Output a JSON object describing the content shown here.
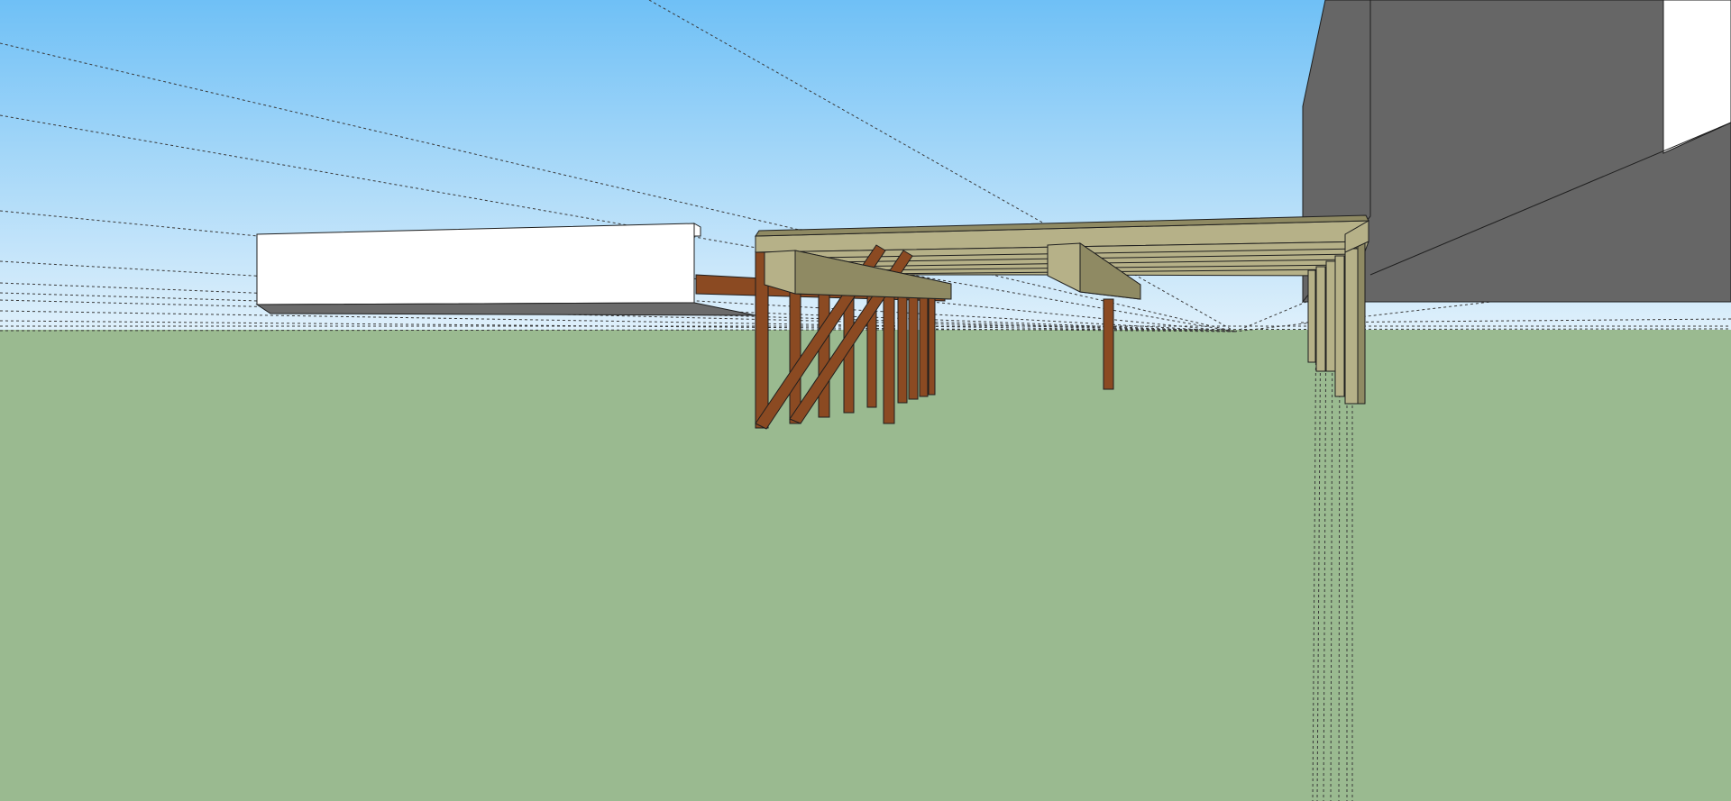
{
  "viewport": {
    "sky_top_color": "#6fc0f6",
    "sky_horizon_color": "#dff0fb",
    "ground_color": "#9aba90",
    "edge_color": "#1f1f1f",
    "guide_line_color": "#3a3a3a"
  },
  "model": {
    "wall_color": "#666666",
    "wall_shadow_color": "#5a5a5a",
    "white_block_color": "#ffffff",
    "wood_light_color": "#b6b188",
    "wood_light_dark_color": "#8f8a63",
    "wood_dark_color": "#8b4a22",
    "wood_dark_shade_color": "#6d3516"
  }
}
